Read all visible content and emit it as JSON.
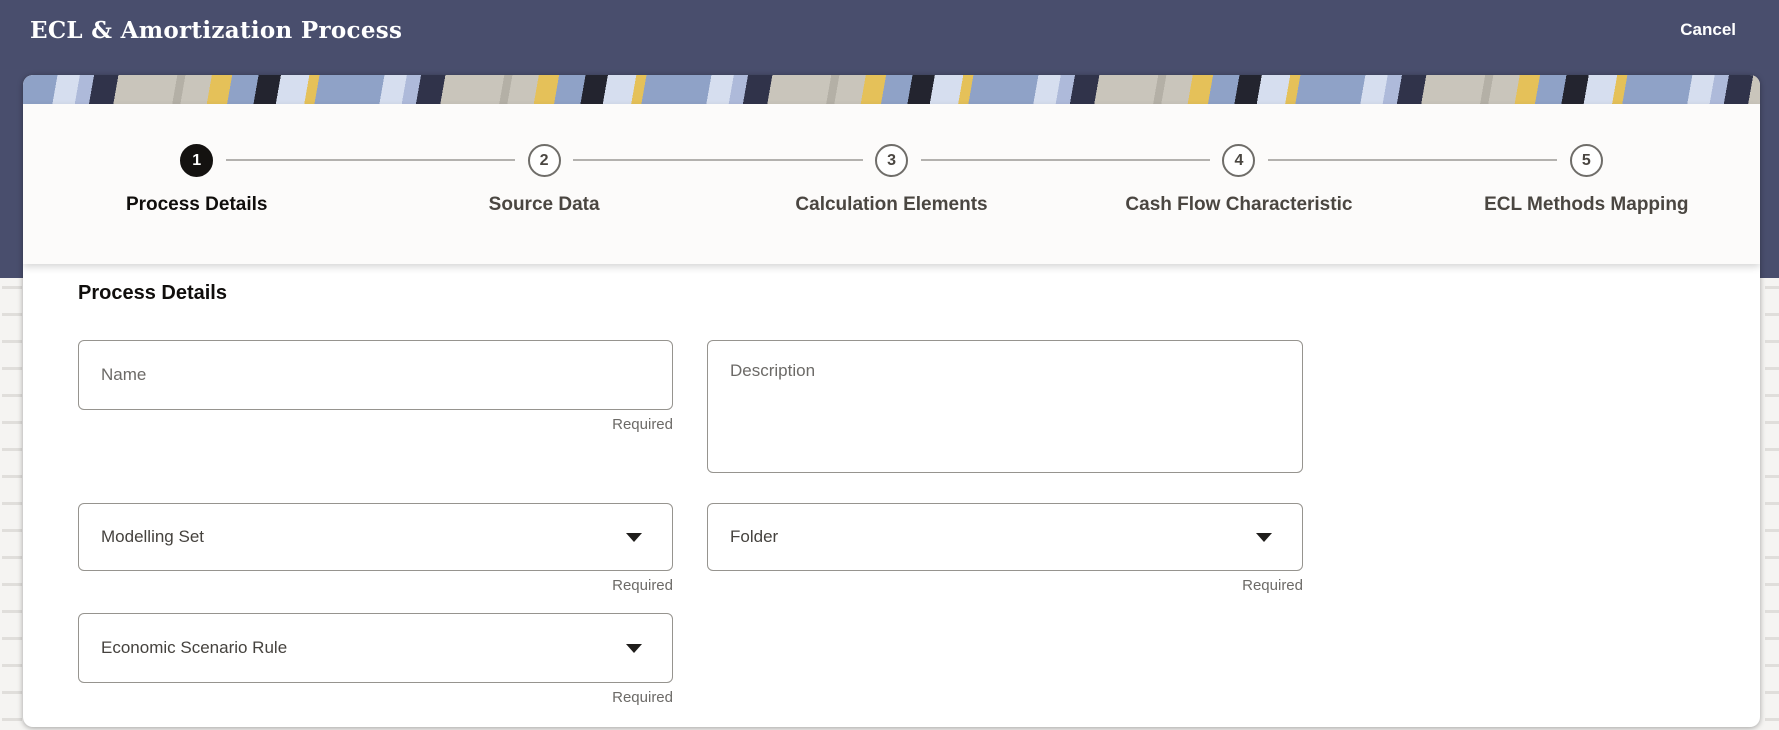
{
  "header": {
    "title": "ECL & Amortization Process",
    "cancel_label": "Cancel"
  },
  "stepper": {
    "steps": [
      {
        "num": "1",
        "label": "Process Details",
        "state": "active"
      },
      {
        "num": "2",
        "label": "Source Data",
        "state": "upcoming"
      },
      {
        "num": "3",
        "label": "Calculation Elements",
        "state": "upcoming"
      },
      {
        "num": "4",
        "label": "Cash Flow Characteristic",
        "state": "upcoming"
      },
      {
        "num": "5",
        "label": "ECL Methods Mapping",
        "state": "upcoming"
      }
    ]
  },
  "form": {
    "section_title": "Process Details",
    "required_label": "Required",
    "name_field": {
      "placeholder": "Name",
      "value": "",
      "required": true
    },
    "description_field": {
      "placeholder": "Description",
      "value": "",
      "required": false
    },
    "modelling_set_field": {
      "label": "Modelling Set",
      "required": true
    },
    "folder_field": {
      "label": "Folder",
      "required": true
    },
    "economic_scenario_rule_field": {
      "label": "Economic Scenario Rule",
      "required": true
    }
  },
  "colors": {
    "header_bg": "#494e6d",
    "step_active_bg": "#141210",
    "accent_required_text": "#6c6a67",
    "pattern_yellow": "#e5c159",
    "pattern_blue": "#8fa2c7",
    "pattern_lightblue": "#d6deef",
    "pattern_dark": "#30334a",
    "pattern_beige": "#c9c5bb"
  }
}
